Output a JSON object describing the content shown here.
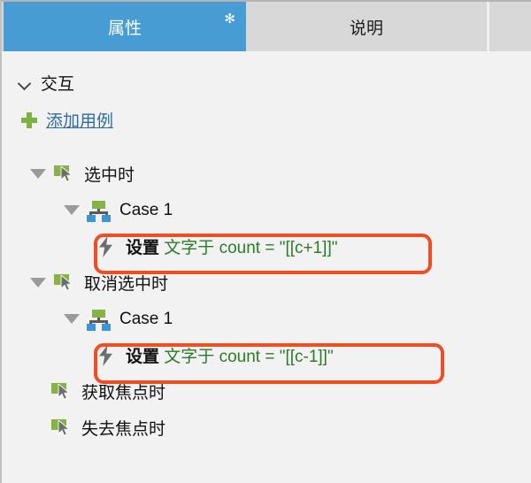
{
  "tabs": [
    {
      "label": "属性",
      "modified_marker": "✻",
      "active": true
    },
    {
      "label": "说明",
      "active": false
    }
  ],
  "section": {
    "title": "交互",
    "toggle_icon": "chevron-down-icon",
    "expanded": true
  },
  "add_case": {
    "label": "添加用例",
    "icon": "plus-icon"
  },
  "tree": [
    {
      "type": "event",
      "label": "选中时",
      "icon": "event-cursor-icon",
      "toggle": "triangle-down-icon",
      "expanded": true
    },
    {
      "type": "case",
      "label": "Case 1",
      "icon": "case-sitemap-icon",
      "toggle": "triangle-down-icon",
      "expanded": true
    },
    {
      "type": "action",
      "icon": "lightning-bolt-icon",
      "verb": "设置",
      "target": "文字于 count = \"[[c+1]]\"",
      "highlighted": true
    },
    {
      "type": "event",
      "label": "取消选中时",
      "icon": "event-cursor-icon",
      "toggle": "triangle-down-icon",
      "expanded": true
    },
    {
      "type": "case",
      "label": "Case 1",
      "icon": "case-sitemap-icon",
      "toggle": "triangle-down-icon",
      "expanded": true
    },
    {
      "type": "action",
      "icon": "lightning-bolt-icon",
      "verb": "设置",
      "target": "文字于 count = \"[[c-1]]\"",
      "highlighted": true
    },
    {
      "type": "event",
      "label": "获取焦点时",
      "icon": "event-cursor-icon",
      "toggle": null,
      "expanded": false
    },
    {
      "type": "event",
      "label": "失去焦点时",
      "icon": "event-cursor-icon",
      "toggle": null,
      "expanded": false
    }
  ],
  "colors": {
    "tab_active_bg": "#469cd3",
    "tab_inactive_bg": "#d8d8d8",
    "panel_bg": "#f2f2f2",
    "link": "#2d6da3",
    "accent_green": "#86b343",
    "action_green": "#2c7b28",
    "highlight_orange": "#f04d23",
    "icon_gray": "#6e6e6e",
    "case_blue": "#3c96d4"
  }
}
